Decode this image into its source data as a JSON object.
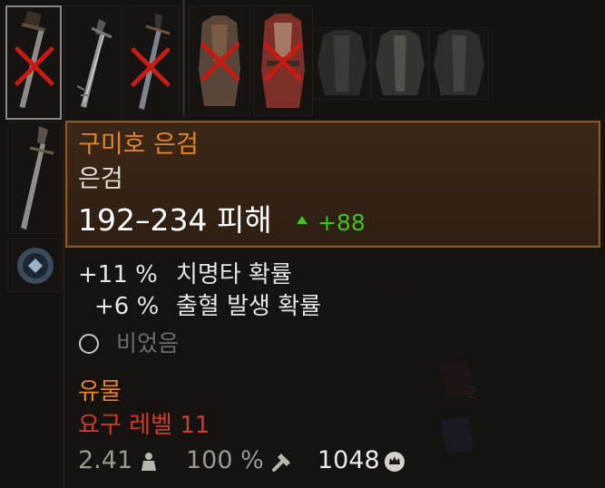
{
  "tooltip": {
    "item_name": "구미호 은검",
    "item_type": "은검",
    "damage": "192–234 피해",
    "damage_increase": "+88",
    "stats": [
      {
        "value": "+11 %",
        "label": "치명타 확률"
      },
      {
        "value": "+6 %",
        "label": "출혈 발생 확률"
      }
    ],
    "socket": "비었음",
    "rarity": "유물",
    "requirement": "요구 레벨 11",
    "weight": "2.41",
    "durability": "100 %",
    "price": "1048"
  },
  "colors": {
    "item_name": "#e2832f",
    "damage_increase": "#3fc31f",
    "requirement": "#d03b2c",
    "header_border": "#8c5a2a",
    "unavailable_mark": "#c61a12"
  },
  "side_badge": "2"
}
